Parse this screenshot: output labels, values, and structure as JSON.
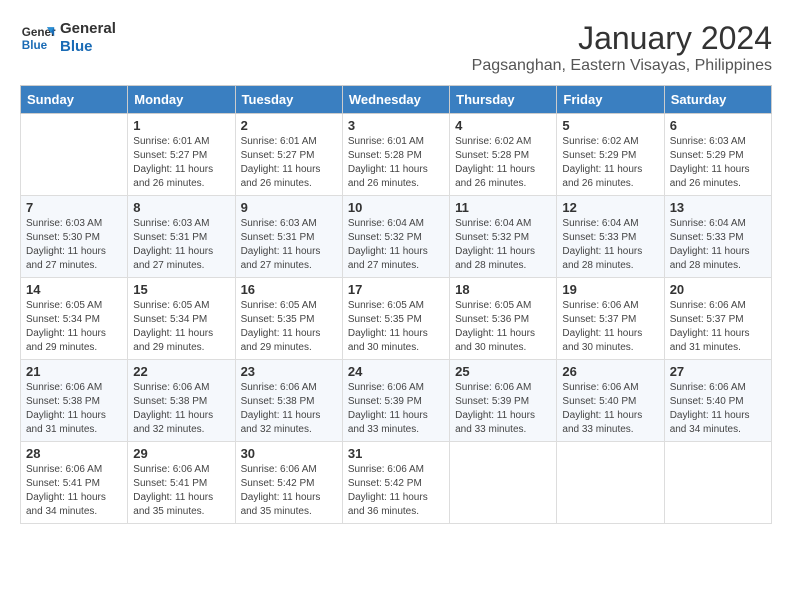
{
  "logo": {
    "line1": "General",
    "line2": "Blue"
  },
  "title": "January 2024",
  "subtitle": "Pagsanghan, Eastern Visayas, Philippines",
  "header_days": [
    "Sunday",
    "Monday",
    "Tuesday",
    "Wednesday",
    "Thursday",
    "Friday",
    "Saturday"
  ],
  "weeks": [
    [
      {
        "day": "",
        "info": ""
      },
      {
        "day": "1",
        "info": "Sunrise: 6:01 AM\nSunset: 5:27 PM\nDaylight: 11 hours\nand 26 minutes."
      },
      {
        "day": "2",
        "info": "Sunrise: 6:01 AM\nSunset: 5:27 PM\nDaylight: 11 hours\nand 26 minutes."
      },
      {
        "day": "3",
        "info": "Sunrise: 6:01 AM\nSunset: 5:28 PM\nDaylight: 11 hours\nand 26 minutes."
      },
      {
        "day": "4",
        "info": "Sunrise: 6:02 AM\nSunset: 5:28 PM\nDaylight: 11 hours\nand 26 minutes."
      },
      {
        "day": "5",
        "info": "Sunrise: 6:02 AM\nSunset: 5:29 PM\nDaylight: 11 hours\nand 26 minutes."
      },
      {
        "day": "6",
        "info": "Sunrise: 6:03 AM\nSunset: 5:29 PM\nDaylight: 11 hours\nand 26 minutes."
      }
    ],
    [
      {
        "day": "7",
        "info": "Sunrise: 6:03 AM\nSunset: 5:30 PM\nDaylight: 11 hours\nand 27 minutes."
      },
      {
        "day": "8",
        "info": "Sunrise: 6:03 AM\nSunset: 5:31 PM\nDaylight: 11 hours\nand 27 minutes."
      },
      {
        "day": "9",
        "info": "Sunrise: 6:03 AM\nSunset: 5:31 PM\nDaylight: 11 hours\nand 27 minutes."
      },
      {
        "day": "10",
        "info": "Sunrise: 6:04 AM\nSunset: 5:32 PM\nDaylight: 11 hours\nand 27 minutes."
      },
      {
        "day": "11",
        "info": "Sunrise: 6:04 AM\nSunset: 5:32 PM\nDaylight: 11 hours\nand 28 minutes."
      },
      {
        "day": "12",
        "info": "Sunrise: 6:04 AM\nSunset: 5:33 PM\nDaylight: 11 hours\nand 28 minutes."
      },
      {
        "day": "13",
        "info": "Sunrise: 6:04 AM\nSunset: 5:33 PM\nDaylight: 11 hours\nand 28 minutes."
      }
    ],
    [
      {
        "day": "14",
        "info": "Sunrise: 6:05 AM\nSunset: 5:34 PM\nDaylight: 11 hours\nand 29 minutes."
      },
      {
        "day": "15",
        "info": "Sunrise: 6:05 AM\nSunset: 5:34 PM\nDaylight: 11 hours\nand 29 minutes."
      },
      {
        "day": "16",
        "info": "Sunrise: 6:05 AM\nSunset: 5:35 PM\nDaylight: 11 hours\nand 29 minutes."
      },
      {
        "day": "17",
        "info": "Sunrise: 6:05 AM\nSunset: 5:35 PM\nDaylight: 11 hours\nand 30 minutes."
      },
      {
        "day": "18",
        "info": "Sunrise: 6:05 AM\nSunset: 5:36 PM\nDaylight: 11 hours\nand 30 minutes."
      },
      {
        "day": "19",
        "info": "Sunrise: 6:06 AM\nSunset: 5:37 PM\nDaylight: 11 hours\nand 30 minutes."
      },
      {
        "day": "20",
        "info": "Sunrise: 6:06 AM\nSunset: 5:37 PM\nDaylight: 11 hours\nand 31 minutes."
      }
    ],
    [
      {
        "day": "21",
        "info": "Sunrise: 6:06 AM\nSunset: 5:38 PM\nDaylight: 11 hours\nand 31 minutes."
      },
      {
        "day": "22",
        "info": "Sunrise: 6:06 AM\nSunset: 5:38 PM\nDaylight: 11 hours\nand 32 minutes."
      },
      {
        "day": "23",
        "info": "Sunrise: 6:06 AM\nSunset: 5:38 PM\nDaylight: 11 hours\nand 32 minutes."
      },
      {
        "day": "24",
        "info": "Sunrise: 6:06 AM\nSunset: 5:39 PM\nDaylight: 11 hours\nand 33 minutes."
      },
      {
        "day": "25",
        "info": "Sunrise: 6:06 AM\nSunset: 5:39 PM\nDaylight: 11 hours\nand 33 minutes."
      },
      {
        "day": "26",
        "info": "Sunrise: 6:06 AM\nSunset: 5:40 PM\nDaylight: 11 hours\nand 33 minutes."
      },
      {
        "day": "27",
        "info": "Sunrise: 6:06 AM\nSunset: 5:40 PM\nDaylight: 11 hours\nand 34 minutes."
      }
    ],
    [
      {
        "day": "28",
        "info": "Sunrise: 6:06 AM\nSunset: 5:41 PM\nDaylight: 11 hours\nand 34 minutes."
      },
      {
        "day": "29",
        "info": "Sunrise: 6:06 AM\nSunset: 5:41 PM\nDaylight: 11 hours\nand 35 minutes."
      },
      {
        "day": "30",
        "info": "Sunrise: 6:06 AM\nSunset: 5:42 PM\nDaylight: 11 hours\nand 35 minutes."
      },
      {
        "day": "31",
        "info": "Sunrise: 6:06 AM\nSunset: 5:42 PM\nDaylight: 11 hours\nand 36 minutes."
      },
      {
        "day": "",
        "info": ""
      },
      {
        "day": "",
        "info": ""
      },
      {
        "day": "",
        "info": ""
      }
    ]
  ]
}
